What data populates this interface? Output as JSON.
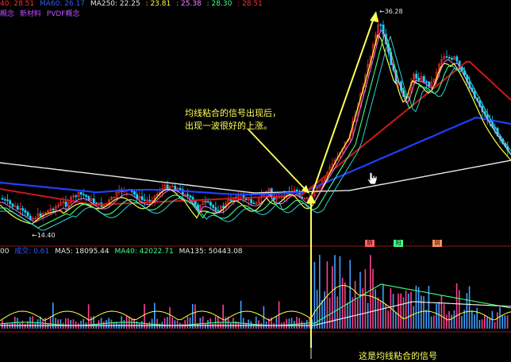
{
  "colors": {
    "background": "#000000",
    "up": "#ff3030",
    "down": "#18d0ff",
    "ma_white": "#e8e8e8",
    "ma_yellow": "#ffff40",
    "ma_green": "#40ff80",
    "ma_blue": "#2040ff",
    "ma_red": "#d01818",
    "annotation": "#ffff5a"
  },
  "price_header": {
    "items": [
      {
        "text": "40: 28.51",
        "color": "#ff3030"
      },
      {
        "text": "MA60: 26.17",
        "color": "#2d5bff"
      },
      {
        "text": "MA250: 22.25",
        "color": "#e6e6e6"
      },
      {
        "text": ": 23.81",
        "color": "#ffff40"
      },
      {
        "text": ": 25.38",
        "color": "#ff80ff"
      },
      {
        "text": ": 28.30",
        "color": "#40ff80"
      },
      {
        "text": ": 28.51",
        "color": "#ff3030"
      }
    ]
  },
  "concept_line": {
    "items": [
      "概念",
      "新材料",
      "PVDF概念"
    ]
  },
  "price_labels": {
    "high": "36.28",
    "low": "14.40"
  },
  "annotations": {
    "main": [
      "均线粘合的信号出现后，",
      "出现一波很好的上涨。"
    ],
    "bottom": "这是均线粘合的信号"
  },
  "volume_header": {
    "items": [
      {
        "text": "00",
        "color": "#e6e6e6"
      },
      {
        "text": "成交: 0.61",
        "color": "#2d5bff"
      },
      {
        "text": "MA5: 18095.44",
        "color": "#e6e6e6"
      },
      {
        "text": "MA40: 42022.71",
        "color": "#40ff80"
      },
      {
        "text": "MA135: 50443.08",
        "color": "#e6e6e6"
      }
    ]
  },
  "signal_tags": [
    {
      "text": "阴",
      "color": "#ff6060"
    },
    {
      "text": "阳",
      "color": "#40ff80"
    },
    {
      "text": "阴",
      "color": "#ff9060"
    }
  ]
}
